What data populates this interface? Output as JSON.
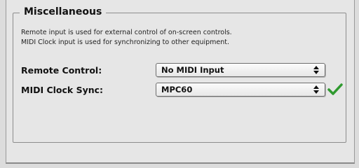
{
  "section": {
    "title": "Miscellaneous",
    "description_line1": "Remote input is used for external control of on-screen controls.",
    "description_line2": "MIDI Clock input is used for synchronizing to other equipment."
  },
  "remote_control": {
    "label": "Remote Control:",
    "value": "No MIDI Input"
  },
  "midi_clock_sync": {
    "label": "MIDI Clock Sync:",
    "value": "MPC60",
    "status_icon": "checkmark-icon",
    "status_color": "#2f9a2f"
  }
}
